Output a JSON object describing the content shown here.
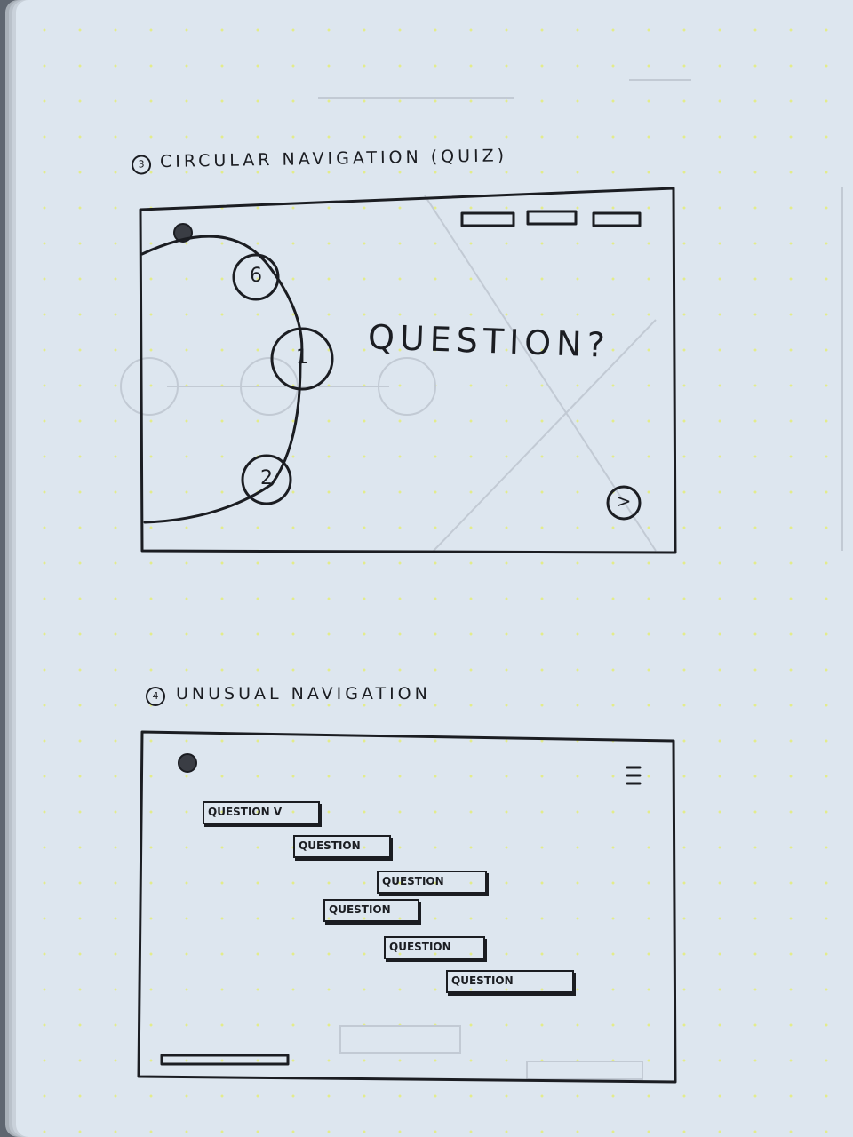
{
  "sketch1": {
    "heading": "CIRCULAR NAVIGATION (QUIZ)",
    "heading_number": "3",
    "question": "QUESTION?",
    "nodes": [
      "6",
      "1",
      "2"
    ],
    "next_button": ">"
  },
  "sketch2": {
    "heading": "UNUSUAL NAVIGATION",
    "heading_number": "4",
    "questions": [
      "QUESTION V",
      "QUESTION",
      "QUESTION",
      "QUESTION",
      "QUESTION",
      "QUESTION"
    ],
    "menu_icon": "hamburger-icon"
  },
  "colors": {
    "paper": "#dde6ef",
    "ink": "#1b1d22",
    "dots": "#e3ec8a"
  }
}
